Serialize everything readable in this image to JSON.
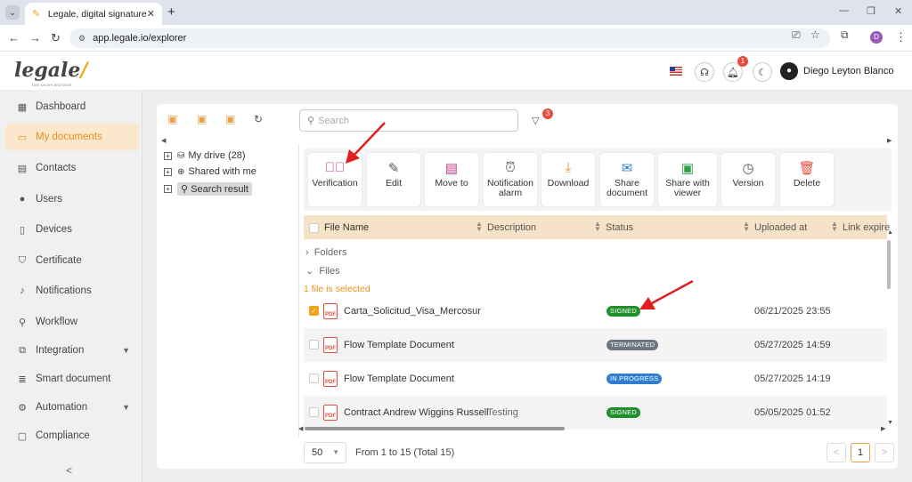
{
  "browser": {
    "tab_title": "Legale, digital signature",
    "url": "app.legale.io/explorer"
  },
  "header": {
    "logo_text": "legale",
    "logo_tagline": "fast, secure and smart",
    "notification_count": "1",
    "user_name": "Diego Leyton Blanco",
    "avatar_initial": "D"
  },
  "sidebar": {
    "items": [
      {
        "label": "Dashboard",
        "icon": "dashboard-icon"
      },
      {
        "label": "My documents",
        "icon": "folder-icon"
      },
      {
        "label": "Contacts",
        "icon": "contacts-icon"
      },
      {
        "label": "Users",
        "icon": "user-icon"
      },
      {
        "label": "Devices",
        "icon": "device-icon"
      },
      {
        "label": "Certificate",
        "icon": "shield-icon"
      },
      {
        "label": "Notifications",
        "icon": "bell-icon"
      },
      {
        "label": "Workflow",
        "icon": "workflow-icon"
      },
      {
        "label": "Integration",
        "icon": "integration-icon"
      },
      {
        "label": "Smart document",
        "icon": "smart-doc-icon"
      },
      {
        "label": "Automation",
        "icon": "gear-icon"
      },
      {
        "label": "Compliance",
        "icon": "compliance-icon"
      }
    ],
    "active_index": 1,
    "collapse_label": "<"
  },
  "explorer": {
    "search_placeholder": "Search",
    "filter_count": "3",
    "tree": [
      {
        "label": "My drive (28)",
        "icon": "drive-icon"
      },
      {
        "label": "Shared with me",
        "icon": "globe-icon"
      },
      {
        "label": "Search result",
        "icon": "search-icon"
      }
    ]
  },
  "actions": [
    {
      "label": "Verification",
      "icon": "verify-icon",
      "color": "#c0398f"
    },
    {
      "label": "Edit",
      "icon": "edit-icon",
      "color": "#555555"
    },
    {
      "label": "Move to",
      "icon": "move-icon",
      "color": "#c0398f"
    },
    {
      "label": "Notification alarm",
      "icon": "alarm-icon",
      "color": "#555555"
    },
    {
      "label": "Download",
      "icon": "download-icon",
      "color": "#e8901b"
    },
    {
      "label": "Share document",
      "icon": "mail-icon",
      "color": "#2f7fd1"
    },
    {
      "label": "Share with viewer",
      "icon": "share-folder-icon",
      "color": "#2e9e48"
    },
    {
      "label": "Version",
      "icon": "version-icon",
      "color": "#555555"
    },
    {
      "label": "Delete",
      "icon": "trash-icon",
      "color": "#e74c3c"
    }
  ],
  "table": {
    "columns": [
      "File Name",
      "Description",
      "Status",
      "Uploaded at",
      "Link expire"
    ],
    "groups": {
      "folders": "Folders",
      "files": "Files"
    },
    "selection_note": "1 file is selected",
    "rows": [
      {
        "name": "Carta_Solicitud_Visa_Mercosur",
        "description": "",
        "status": "SIGNED",
        "status_color": "#1f8f2e",
        "uploaded": "06/21/2025 23:55",
        "checked": true
      },
      {
        "name": "Flow Template Document",
        "description": "",
        "status": "TERMINATED",
        "status_color": "#6b7480",
        "uploaded": "05/27/2025 14:59",
        "checked": false
      },
      {
        "name": "Flow Template Document",
        "description": "",
        "status": "IN PROGRESS",
        "status_color": "#2f7fd1",
        "uploaded": "05/27/2025 14:19",
        "checked": false
      },
      {
        "name": "Contract Andrew Wiggins Russell",
        "description": "Testing",
        "status": "SIGNED",
        "status_color": "#1f8f2e",
        "uploaded": "05/05/2025 01:52",
        "checked": false
      }
    ]
  },
  "pagination": {
    "page_size": "50",
    "info": "From 1 to 15 (Total 15)",
    "current_page": "1",
    "prev": "<",
    "next": ">"
  },
  "colors": {
    "accent": "#e8901b",
    "table_header": "#f6e2c6",
    "annotation_arrow": "#e02020"
  }
}
